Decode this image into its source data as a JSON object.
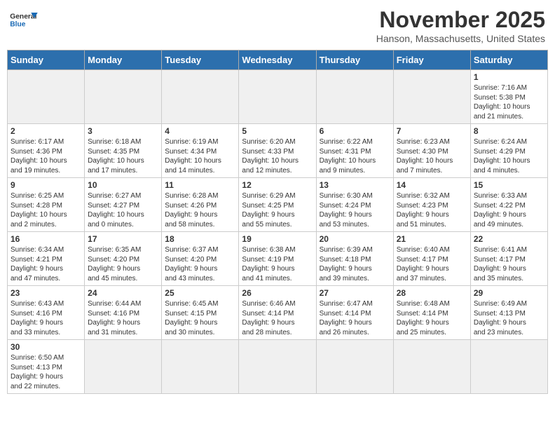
{
  "header": {
    "logo_general": "General",
    "logo_blue": "Blue",
    "title": "November 2025",
    "subtitle": "Hanson, Massachusetts, United States"
  },
  "days_of_week": [
    "Sunday",
    "Monday",
    "Tuesday",
    "Wednesday",
    "Thursday",
    "Friday",
    "Saturday"
  ],
  "weeks": [
    [
      {
        "day": "",
        "empty": true
      },
      {
        "day": "",
        "empty": true
      },
      {
        "day": "",
        "empty": true
      },
      {
        "day": "",
        "empty": true
      },
      {
        "day": "",
        "empty": true
      },
      {
        "day": "",
        "empty": true
      },
      {
        "day": "1",
        "info": "Sunrise: 7:16 AM\nSunset: 5:38 PM\nDaylight: 10 hours\nand 21 minutes."
      }
    ],
    [
      {
        "day": "2",
        "info": "Sunrise: 6:17 AM\nSunset: 4:36 PM\nDaylight: 10 hours\nand 19 minutes."
      },
      {
        "day": "3",
        "info": "Sunrise: 6:18 AM\nSunset: 4:35 PM\nDaylight: 10 hours\nand 17 minutes."
      },
      {
        "day": "4",
        "info": "Sunrise: 6:19 AM\nSunset: 4:34 PM\nDaylight: 10 hours\nand 14 minutes."
      },
      {
        "day": "5",
        "info": "Sunrise: 6:20 AM\nSunset: 4:33 PM\nDaylight: 10 hours\nand 12 minutes."
      },
      {
        "day": "6",
        "info": "Sunrise: 6:22 AM\nSunset: 4:31 PM\nDaylight: 10 hours\nand 9 minutes."
      },
      {
        "day": "7",
        "info": "Sunrise: 6:23 AM\nSunset: 4:30 PM\nDaylight: 10 hours\nand 7 minutes."
      },
      {
        "day": "8",
        "info": "Sunrise: 6:24 AM\nSunset: 4:29 PM\nDaylight: 10 hours\nand 4 minutes."
      }
    ],
    [
      {
        "day": "9",
        "info": "Sunrise: 6:25 AM\nSunset: 4:28 PM\nDaylight: 10 hours\nand 2 minutes."
      },
      {
        "day": "10",
        "info": "Sunrise: 6:27 AM\nSunset: 4:27 PM\nDaylight: 10 hours\nand 0 minutes."
      },
      {
        "day": "11",
        "info": "Sunrise: 6:28 AM\nSunset: 4:26 PM\nDaylight: 9 hours\nand 58 minutes."
      },
      {
        "day": "12",
        "info": "Sunrise: 6:29 AM\nSunset: 4:25 PM\nDaylight: 9 hours\nand 55 minutes."
      },
      {
        "day": "13",
        "info": "Sunrise: 6:30 AM\nSunset: 4:24 PM\nDaylight: 9 hours\nand 53 minutes."
      },
      {
        "day": "14",
        "info": "Sunrise: 6:32 AM\nSunset: 4:23 PM\nDaylight: 9 hours\nand 51 minutes."
      },
      {
        "day": "15",
        "info": "Sunrise: 6:33 AM\nSunset: 4:22 PM\nDaylight: 9 hours\nand 49 minutes."
      }
    ],
    [
      {
        "day": "16",
        "info": "Sunrise: 6:34 AM\nSunset: 4:21 PM\nDaylight: 9 hours\nand 47 minutes."
      },
      {
        "day": "17",
        "info": "Sunrise: 6:35 AM\nSunset: 4:20 PM\nDaylight: 9 hours\nand 45 minutes."
      },
      {
        "day": "18",
        "info": "Sunrise: 6:37 AM\nSunset: 4:20 PM\nDaylight: 9 hours\nand 43 minutes."
      },
      {
        "day": "19",
        "info": "Sunrise: 6:38 AM\nSunset: 4:19 PM\nDaylight: 9 hours\nand 41 minutes."
      },
      {
        "day": "20",
        "info": "Sunrise: 6:39 AM\nSunset: 4:18 PM\nDaylight: 9 hours\nand 39 minutes."
      },
      {
        "day": "21",
        "info": "Sunrise: 6:40 AM\nSunset: 4:17 PM\nDaylight: 9 hours\nand 37 minutes."
      },
      {
        "day": "22",
        "info": "Sunrise: 6:41 AM\nSunset: 4:17 PM\nDaylight: 9 hours\nand 35 minutes."
      }
    ],
    [
      {
        "day": "23",
        "info": "Sunrise: 6:43 AM\nSunset: 4:16 PM\nDaylight: 9 hours\nand 33 minutes."
      },
      {
        "day": "24",
        "info": "Sunrise: 6:44 AM\nSunset: 4:16 PM\nDaylight: 9 hours\nand 31 minutes."
      },
      {
        "day": "25",
        "info": "Sunrise: 6:45 AM\nSunset: 4:15 PM\nDaylight: 9 hours\nand 30 minutes."
      },
      {
        "day": "26",
        "info": "Sunrise: 6:46 AM\nSunset: 4:14 PM\nDaylight: 9 hours\nand 28 minutes."
      },
      {
        "day": "27",
        "info": "Sunrise: 6:47 AM\nSunset: 4:14 PM\nDaylight: 9 hours\nand 26 minutes."
      },
      {
        "day": "28",
        "info": "Sunrise: 6:48 AM\nSunset: 4:14 PM\nDaylight: 9 hours\nand 25 minutes."
      },
      {
        "day": "29",
        "info": "Sunrise: 6:49 AM\nSunset: 4:13 PM\nDaylight: 9 hours\nand 23 minutes."
      }
    ],
    [
      {
        "day": "30",
        "info": "Sunrise: 6:50 AM\nSunset: 4:13 PM\nDaylight: 9 hours\nand 22 minutes."
      },
      {
        "day": "",
        "empty": true
      },
      {
        "day": "",
        "empty": true
      },
      {
        "day": "",
        "empty": true
      },
      {
        "day": "",
        "empty": true
      },
      {
        "day": "",
        "empty": true
      },
      {
        "day": "",
        "empty": true
      }
    ]
  ]
}
